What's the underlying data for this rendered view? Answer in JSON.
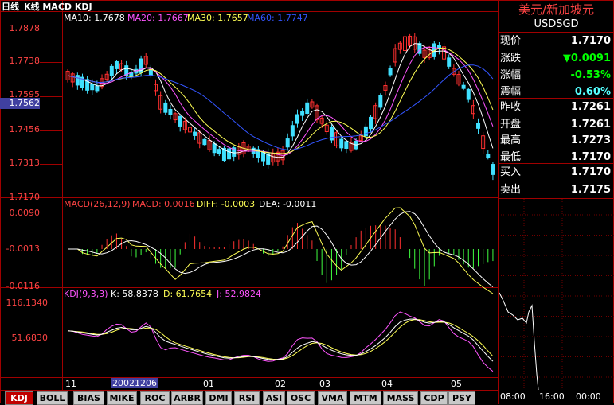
{
  "header": {
    "period": "日线",
    "indicators": "K线 MACD KDJ",
    "ma": [
      {
        "label": "MA10: 1.7678",
        "color": "#ffffff"
      },
      {
        "label": "MA20: 1.7667",
        "color": "#ff55ff"
      },
      {
        "label": "MA30: 1.7657",
        "color": "#ffff55"
      },
      {
        "label": "MA60: 1.7747",
        "color": "#3355ff"
      }
    ]
  },
  "price_axis": [
    "1.7878",
    "1.7738",
    "1.7595",
    "1.7456",
    "1.7313",
    "1.7170"
  ],
  "cursor_price": "1.7562",
  "macd": {
    "title": "MACD(26,12,9)",
    "macd_label": "MACD: 0.0016",
    "diff_label": "DIFF: -0.0003",
    "dea_label": "DEA: -0.0011",
    "axis": [
      "0.0090",
      "-0.0013",
      "-0.0116"
    ]
  },
  "kdj": {
    "title": "KDJ(9,3,3)",
    "k_label": "K: 58.8378",
    "d_label": "D: 61.7654",
    "j_label": "J: 52.9824",
    "axis": [
      "116.1340",
      "51.6830"
    ]
  },
  "time_axis": [
    "11",
    "01",
    "02",
    "03",
    "04",
    "05"
  ],
  "cursor_date": "20021206",
  "quote": {
    "name": "美元/新加坡元",
    "code": "USDSGD",
    "rows": [
      {
        "key": "现价",
        "value": "1.7170",
        "color": "#ffffff"
      },
      {
        "key": "涨跌",
        "value": "▼0.0091",
        "color": "#00ff00"
      },
      {
        "key": "涨幅",
        "value": "-0.53%",
        "color": "#00ff00"
      },
      {
        "key": "震幅",
        "value": "0.60%",
        "color": "#55ffff"
      },
      {
        "key": "昨收",
        "value": "1.7261",
        "color": "#ffffff"
      },
      {
        "key": "开盘",
        "value": "1.7261",
        "color": "#ffffff"
      },
      {
        "key": "最高",
        "value": "1.7273",
        "color": "#ffffff"
      },
      {
        "key": "最低",
        "value": "1.7170",
        "color": "#ffffff"
      },
      {
        "key": "买入",
        "value": "1.7170",
        "color": "#ffffff"
      },
      {
        "key": "卖出",
        "value": "1.7175",
        "color": "#ffffff"
      }
    ]
  },
  "intraday_axis": [
    "08:00",
    "16:00",
    "00:00"
  ],
  "tabs": [
    "KDJ",
    "BOLL",
    "BIAS",
    "MIKE",
    "ROC",
    "ARBR",
    "DMI",
    "RSI",
    "ASI",
    "OSC",
    "VMA",
    "MTM",
    "MASS",
    "CDP",
    "PSY"
  ],
  "active_tab": "KDJ"
}
